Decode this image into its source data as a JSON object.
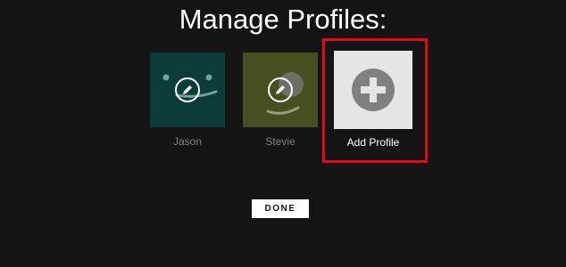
{
  "page": {
    "title": "Manage Profiles:"
  },
  "profiles": [
    {
      "name": "Jason",
      "avatar_color": "#10504e",
      "icon": "smiley-face-icon",
      "edit_icon": "pencil-edit-icon"
    },
    {
      "name": "Stevie",
      "avatar_color": "#5c6b2c",
      "icon": "smiley-face-icon",
      "edit_icon": "pencil-edit-icon"
    }
  ],
  "add_profile": {
    "label": "Add Profile",
    "icon": "plus-circle-icon",
    "tile_color": "#e5e5e5",
    "highlight_color": "#e50914"
  },
  "actions": {
    "done_label": "DONE"
  }
}
